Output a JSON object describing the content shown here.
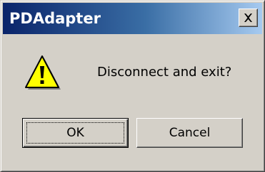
{
  "window": {
    "title": "PDAdapter",
    "close_icon": "close-icon"
  },
  "dialog": {
    "icon": "warning-icon",
    "message": "Disconnect and exit?"
  },
  "buttons": {
    "ok_label": "OK",
    "cancel_label": "Cancel"
  },
  "colors": {
    "titlebar_start": "#0a246a",
    "titlebar_end": "#a6caf0",
    "dialog_face": "#d4d0c8",
    "warning_fill": "#ffff00"
  }
}
